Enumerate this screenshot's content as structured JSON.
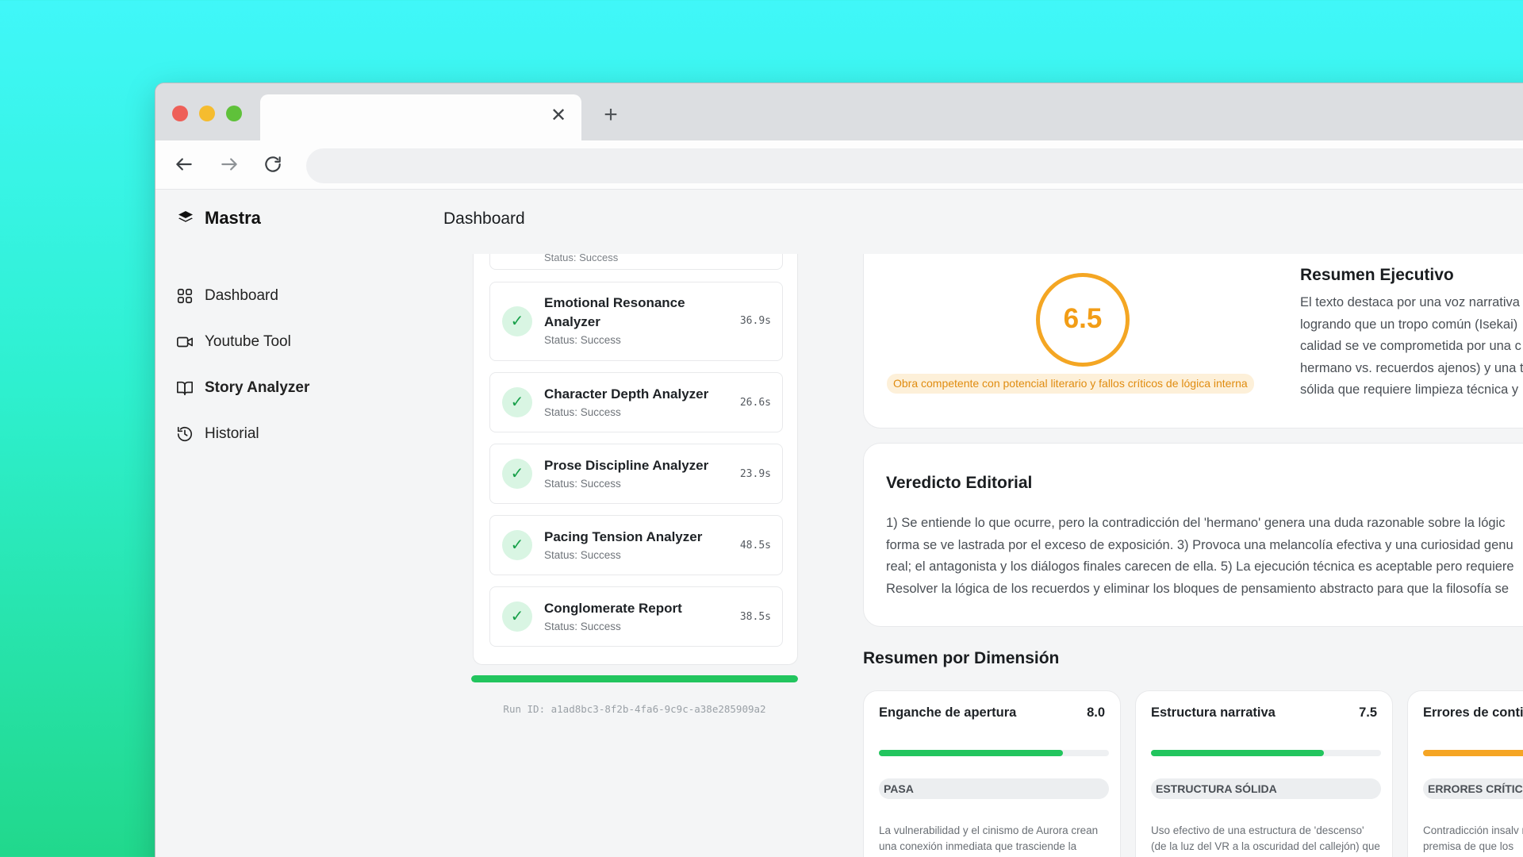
{
  "browser": {
    "tab_close_label": "✕",
    "newtab_label": "+"
  },
  "brand": {
    "name": "Mastra"
  },
  "header": {
    "title": "Dashboard"
  },
  "sidebar": {
    "items": [
      {
        "label": "Dashboard",
        "icon": "grid-icon"
      },
      {
        "label": "Youtube Tool",
        "icon": "video-icon"
      },
      {
        "label": "Story Analyzer",
        "icon": "book-icon"
      },
      {
        "label": "Historial",
        "icon": "history-icon"
      }
    ]
  },
  "steps": {
    "clipped_status": "Status: Success",
    "items": [
      {
        "name": "Emotional Resonance Analyzer",
        "status": "Status: Success",
        "time": "36.9s"
      },
      {
        "name": "Character Depth Analyzer",
        "status": "Status: Success",
        "time": "26.6s"
      },
      {
        "name": "Prose Discipline Analyzer",
        "status": "Status: Success",
        "time": "23.9s"
      },
      {
        "name": "Pacing Tension Analyzer",
        "status": "Status: Success",
        "time": "48.5s"
      },
      {
        "name": "Conglomerate Report",
        "status": "Status: Success",
        "time": "38.5s"
      }
    ],
    "progress": 1.0,
    "run_id": "Run ID: a1ad8bc3-8f2b-4fa6-9c9c-a38e285909a2"
  },
  "score": {
    "value": "6.5",
    "label": "Obra competente con potencial literario y fallos críticos de lógica interna"
  },
  "executive_summary": {
    "title": "Resumen Ejecutivo",
    "lines": [
      "El texto destaca por una voz narrativa",
      "logrando que un tropo común (Isekai)",
      "calidad se ve comprometida por una c",
      "hermano vs. recuerdos ajenos) y una t",
      "sólida que requiere limpieza técnica y"
    ]
  },
  "verdict": {
    "title": "Veredicto Editorial",
    "lines": [
      "1) Se entiende lo que ocurre, pero la contradicción del 'hermano' genera una duda razonable sobre la lógic",
      "forma se ve lastrada por el exceso de exposición. 3) Provoca una melancolía efectiva y una curiosidad genu",
      "real; el antagonista y los diálogos finales carecen de ella. 5) La ejecución técnica es aceptable pero requiere",
      "Resolver la lógica de los recuerdos y eliminar los bloques de pensamiento abstracto para que la filosofía se"
    ]
  },
  "dimensions": {
    "title": "Resumen por Dimensión",
    "items": [
      {
        "name": "Enganche de apertura",
        "score": "8.0",
        "fill": 0.8,
        "color": "#22c55e",
        "tag": "PASA",
        "desc": "La vulnerabilidad y el cinismo de Aurora crean una conexión inmediata que trasciende la acción externa."
      },
      {
        "name": "Estructura narrativa",
        "score": "7.5",
        "fill": 0.75,
        "color": "#22c55e",
        "tag": "ESTRUCTURA SÓLIDA",
        "desc": "Uso efectivo de una estructura de 'descenso' (de la luz del VR a la oscuridad del callejón) que refuerza el tema."
      },
      {
        "name": "Errores de contir",
        "score": "",
        "fill": 0.5,
        "color": "#f5a524",
        "tag": "ERRORES CRÍTICOS",
        "desc": "Contradicción insalv reconocimiento em premisa de que los"
      }
    ]
  }
}
